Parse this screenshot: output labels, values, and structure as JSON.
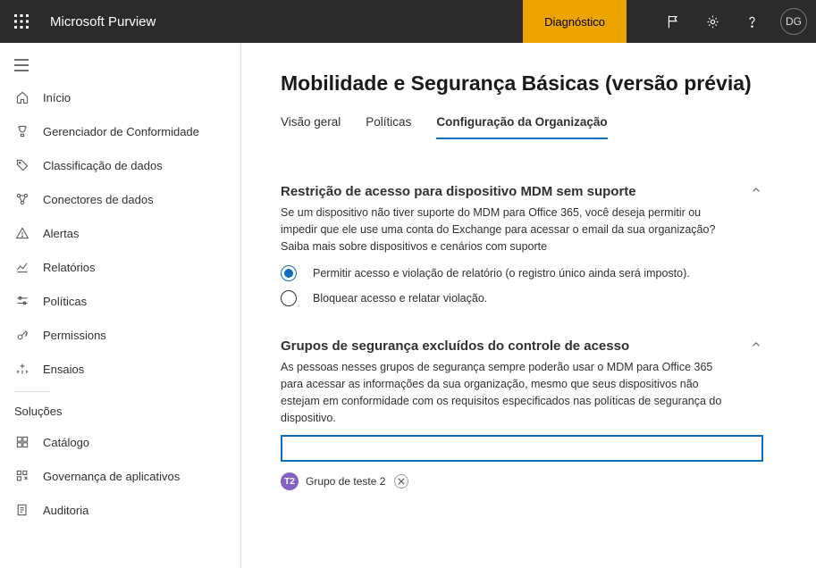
{
  "topbar": {
    "brand": "Microsoft Purview",
    "diagnostic_label": "Diagnóstico",
    "avatar_initials": "DG"
  },
  "sidebar": {
    "items": [
      {
        "label": "Início"
      },
      {
        "label": "Gerenciador de Conformidade"
      },
      {
        "label": "Classificação de dados"
      },
      {
        "label": "Conectores de dados"
      },
      {
        "label": "Alertas"
      },
      {
        "label": "Relatórios"
      },
      {
        "label": "Políticas"
      },
      {
        "label": "Permissions"
      },
      {
        "label": "Ensaios"
      }
    ],
    "group_label": "Soluções",
    "solutions": [
      {
        "label": "Catálogo"
      },
      {
        "label": "Governança de aplicativos"
      },
      {
        "label": "Auditoria"
      }
    ]
  },
  "main": {
    "title": "Mobilidade e Segurança Básicas (versão prévia)",
    "tabs": [
      {
        "label": "Visão geral"
      },
      {
        "label": "Políticas"
      },
      {
        "label": "Configuração da Organização"
      }
    ],
    "section_access": {
      "title": "Restrição de acesso para dispositivo MDM sem suporte",
      "desc": "Se um dispositivo não tiver suporte do MDM para Office 365, você deseja permitir ou impedir que ele use uma conta do Exchange para acessar o email da sua organização? Saiba mais sobre dispositivos e cenários com suporte",
      "radio_allow": "Permitir acesso e violação de relatório (o registro único ainda será imposto).",
      "radio_block": "Bloquear acesso e relatar violação."
    },
    "section_excl": {
      "title": "Grupos de segurança excluídos do controle de acesso",
      "desc": "As pessoas nesses grupos de segurança sempre poderão usar o MDM para Office 365 para acessar as informações da sua organização, mesmo que seus dispositivos não estejam em conformidade com os requisitos especificados nas políticas de segurança do dispositivo.",
      "chip_initials": "T2",
      "chip_label": "Grupo de teste 2"
    }
  }
}
